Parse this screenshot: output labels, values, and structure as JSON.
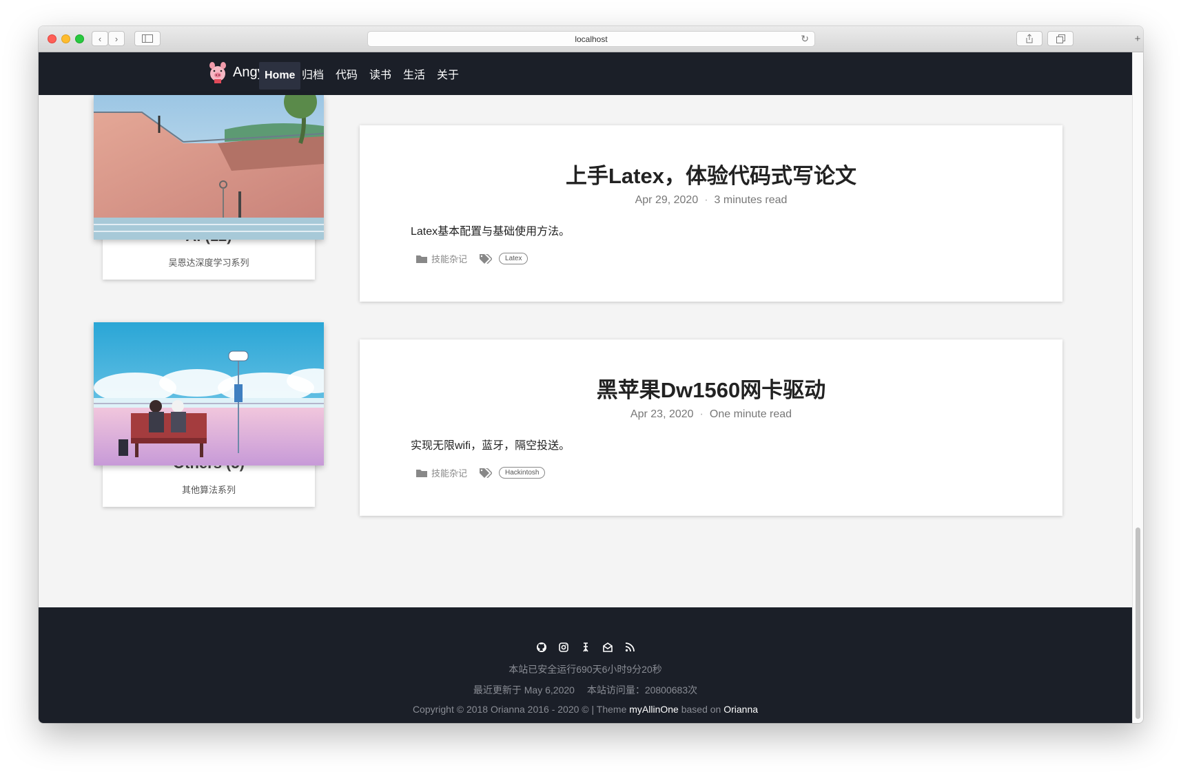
{
  "browser": {
    "address": "localhost"
  },
  "nav": {
    "brand": "Angyi",
    "items": [
      {
        "label": "Home"
      },
      {
        "label": "归档"
      },
      {
        "label": "代码"
      },
      {
        "label": "读书"
      },
      {
        "label": "生活"
      },
      {
        "label": "关于"
      }
    ]
  },
  "categories": [
    {
      "title": "Ai (12)",
      "subtitle": "吴恩达深度学习系列"
    },
    {
      "title": "Others (5)",
      "subtitle": "其他算法系列"
    }
  ],
  "posts": [
    {
      "title": "上手Latex，体验代码式写论文",
      "date": "Apr 29, 2020",
      "read": "3 minutes read",
      "excerpt": "Latex基本配置与基础使用方法。",
      "category": "技能杂记",
      "tag": "Latex"
    },
    {
      "title": "黑苹果Dw1560网卡驱动",
      "date": "Apr 23, 2020",
      "read": "One minute read",
      "excerpt": "实现无限wifi，蓝牙，隔空投送。",
      "category": "技能杂记",
      "tag": "Hackintosh"
    }
  ],
  "footer": {
    "social_icons": [
      "github-icon",
      "instagram-icon",
      "zhihu-icon",
      "mail-icon",
      "rss-icon"
    ],
    "uptime": "本站已安全运行690天6小时9分20秒",
    "updated": "最近更新于 May 6,2020",
    "visits": "本站访问量：20800683次",
    "copyright_prefix": "Copyright © 2018 Orianna 2016 - 2020 © | Theme",
    "theme_name": "myAllinOne",
    "based_on": "based on",
    "base_theme": "Orianna"
  }
}
